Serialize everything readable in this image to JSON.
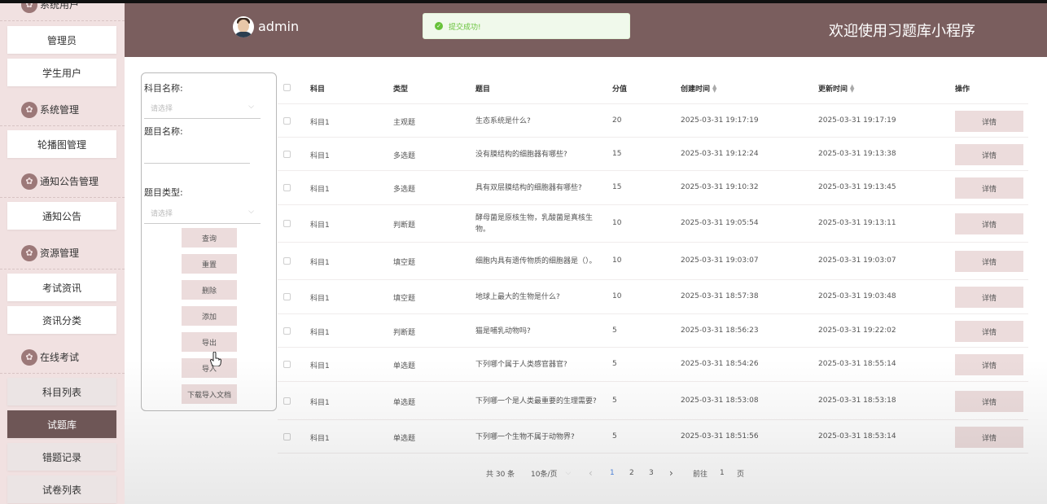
{
  "sidebar": {
    "groups": [
      {
        "label": "系统用户",
        "icon": "flower-icon"
      },
      {
        "label": "系统管理",
        "icon": "flower-icon"
      },
      {
        "label": "通知公告管理",
        "icon": "flower-icon"
      },
      {
        "label": "资源管理",
        "icon": "flower-icon"
      },
      {
        "label": "在线考试",
        "icon": "flower-icon"
      }
    ],
    "items": [
      {
        "label": "管理员"
      },
      {
        "label": "学生用户"
      },
      {
        "label": "轮播图管理"
      },
      {
        "label": "通知公告"
      },
      {
        "label": "考试资讯"
      },
      {
        "label": "资讯分类"
      },
      {
        "label": "科目列表"
      },
      {
        "label": "试题库"
      },
      {
        "label": "错题记录"
      },
      {
        "label": "试卷列表"
      }
    ]
  },
  "header": {
    "username": "admin",
    "welcome": "欢迎使用习题库小程序",
    "toast": "提交成功!",
    "bg_color": "#7a5e5e"
  },
  "search": {
    "subject_label": "科目名称:",
    "subject_placeholder": "请选择",
    "question_label": "题目名称:",
    "type_label": "题目类型:",
    "type_placeholder": "请选择",
    "buttons": {
      "query": "查询",
      "reset": "重置",
      "delete": "删除",
      "add": "添加",
      "export": "导出",
      "import": "导入",
      "download_template": "下载导入文档"
    }
  },
  "table": {
    "headers": {
      "subject": "科目",
      "type": "类型",
      "question": "题目",
      "score": "分值",
      "created": "创建时间",
      "updated": "更新时间",
      "action": "操作"
    },
    "rows": [
      {
        "subject": "科目1",
        "type": "主观题",
        "question": "生态系统是什么?",
        "score": "20",
        "created": "2025-03-31 19:17:19",
        "updated": "2025-03-31 19:17:19",
        "action": "详情"
      },
      {
        "subject": "科目1",
        "type": "多选题",
        "question": "没有膜结构的细胞器有哪些?",
        "score": "15",
        "created": "2025-03-31 19:12:24",
        "updated": "2025-03-31 19:13:38",
        "action": "详情"
      },
      {
        "subject": "科目1",
        "type": "多选题",
        "question": "具有双层膜结构的细胞器有哪些?",
        "score": "15",
        "created": "2025-03-31 19:10:32",
        "updated": "2025-03-31 19:13:45",
        "action": "详情"
      },
      {
        "subject": "科目1",
        "type": "判断题",
        "question": "酵母菌是原核生物，乳酸菌是真核生物。",
        "score": "10",
        "created": "2025-03-31 19:05:54",
        "updated": "2025-03-31 19:13:11",
        "action": "详情"
      },
      {
        "subject": "科目1",
        "type": "填空题",
        "question": "细胞内具有遗传物质的细胞器是（）。",
        "score": "10",
        "created": "2025-03-31 19:03:07",
        "updated": "2025-03-31 19:03:07",
        "action": "详情"
      },
      {
        "subject": "科目1",
        "type": "填空题",
        "question": "地球上最大的生物是什么?",
        "score": "10",
        "created": "2025-03-31 18:57:38",
        "updated": "2025-03-31 19:03:48",
        "action": "详情"
      },
      {
        "subject": "科目1",
        "type": "判断题",
        "question": "猫是哺乳动物吗?",
        "score": "5",
        "created": "2025-03-31 18:56:23",
        "updated": "2025-03-31 19:22:02",
        "action": "详情"
      },
      {
        "subject": "科目1",
        "type": "单选题",
        "question": "下列哪个属于人类感官器官?",
        "score": "5",
        "created": "2025-03-31 18:54:26",
        "updated": "2025-03-31 18:55:14",
        "action": "详情"
      },
      {
        "subject": "科目1",
        "type": "单选题",
        "question": "下列哪一个是人类最重要的生理需要?",
        "score": "5",
        "created": "2025-03-31 18:53:08",
        "updated": "2025-03-31 18:53:18",
        "action": "详情"
      },
      {
        "subject": "科目1",
        "type": "单选题",
        "question": "下列哪一个生物不属于动物界?",
        "score": "5",
        "created": "2025-03-31 18:51:56",
        "updated": "2025-03-31 18:53:14",
        "action": "详情"
      }
    ]
  },
  "pagination": {
    "total": "共 30 条",
    "page_size": "10条/页",
    "prev": "‹",
    "pages": [
      "1",
      "2",
      "3"
    ],
    "current": "1",
    "next": "›",
    "goto_label": "前往",
    "goto_value": "1",
    "goto_suffix": "页"
  }
}
